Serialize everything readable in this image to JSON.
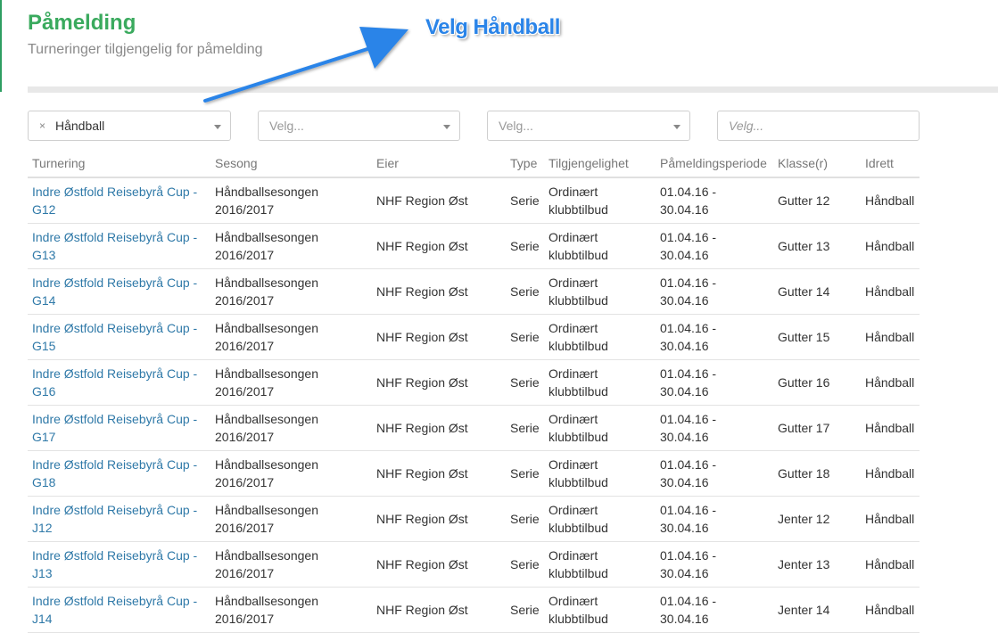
{
  "header": {
    "title": "Påmelding",
    "subtitle": "Turneringer tilgjengelig for påmelding"
  },
  "annotation": {
    "text": "Velg Håndball",
    "color": "#2a84e8"
  },
  "filters": {
    "sport": {
      "clear_symbol": "×",
      "value": "Håndball"
    },
    "filter2": {
      "placeholder": "Velg..."
    },
    "filter3": {
      "placeholder": "Velg..."
    },
    "search": {
      "placeholder": "Velg..."
    }
  },
  "table": {
    "columns": [
      "Turnering",
      "Sesong",
      "Eier",
      "Type",
      "Tilgjengelighet",
      "Påmeldingsperiode",
      "Klasse(r)",
      "Idrett"
    ],
    "rows": [
      {
        "turnering": [
          "Indre Østfold Reisebyrå Cup -",
          "G12"
        ],
        "sesong": [
          "Håndballsesongen",
          "2016/2017"
        ],
        "eier": "NHF Region Øst",
        "type": "Serie",
        "tilgjengelighet": [
          "Ordinært",
          "klubbtilbud"
        ],
        "periode": [
          "01.04.16 -",
          "30.04.16"
        ],
        "klasse": "Gutter 12",
        "idrett": "Håndball"
      },
      {
        "turnering": [
          "Indre Østfold Reisebyrå Cup -",
          "G13"
        ],
        "sesong": [
          "Håndballsesongen",
          "2016/2017"
        ],
        "eier": "NHF Region Øst",
        "type": "Serie",
        "tilgjengelighet": [
          "Ordinært",
          "klubbtilbud"
        ],
        "periode": [
          "01.04.16 -",
          "30.04.16"
        ],
        "klasse": "Gutter 13",
        "idrett": "Håndball"
      },
      {
        "turnering": [
          "Indre Østfold Reisebyrå Cup -",
          "G14"
        ],
        "sesong": [
          "Håndballsesongen",
          "2016/2017"
        ],
        "eier": "NHF Region Øst",
        "type": "Serie",
        "tilgjengelighet": [
          "Ordinært",
          "klubbtilbud"
        ],
        "periode": [
          "01.04.16 -",
          "30.04.16"
        ],
        "klasse": "Gutter 14",
        "idrett": "Håndball"
      },
      {
        "turnering": [
          "Indre Østfold Reisebyrå Cup -",
          "G15"
        ],
        "sesong": [
          "Håndballsesongen",
          "2016/2017"
        ],
        "eier": "NHF Region Øst",
        "type": "Serie",
        "tilgjengelighet": [
          "Ordinært",
          "klubbtilbud"
        ],
        "periode": [
          "01.04.16 -",
          "30.04.16"
        ],
        "klasse": "Gutter 15",
        "idrett": "Håndball"
      },
      {
        "turnering": [
          "Indre Østfold Reisebyrå Cup -",
          "G16"
        ],
        "sesong": [
          "Håndballsesongen",
          "2016/2017"
        ],
        "eier": "NHF Region Øst",
        "type": "Serie",
        "tilgjengelighet": [
          "Ordinært",
          "klubbtilbud"
        ],
        "periode": [
          "01.04.16 -",
          "30.04.16"
        ],
        "klasse": "Gutter 16",
        "idrett": "Håndball"
      },
      {
        "turnering": [
          "Indre Østfold Reisebyrå Cup -",
          "G17"
        ],
        "sesong": [
          "Håndballsesongen",
          "2016/2017"
        ],
        "eier": "NHF Region Øst",
        "type": "Serie",
        "tilgjengelighet": [
          "Ordinært",
          "klubbtilbud"
        ],
        "periode": [
          "01.04.16 -",
          "30.04.16"
        ],
        "klasse": "Gutter 17",
        "idrett": "Håndball"
      },
      {
        "turnering": [
          "Indre Østfold Reisebyrå Cup -",
          "G18"
        ],
        "sesong": [
          "Håndballsesongen",
          "2016/2017"
        ],
        "eier": "NHF Region Øst",
        "type": "Serie",
        "tilgjengelighet": [
          "Ordinært",
          "klubbtilbud"
        ],
        "periode": [
          "01.04.16 -",
          "30.04.16"
        ],
        "klasse": "Gutter 18",
        "idrett": "Håndball"
      },
      {
        "turnering": [
          "Indre Østfold Reisebyrå Cup -",
          "J12"
        ],
        "sesong": [
          "Håndballsesongen",
          "2016/2017"
        ],
        "eier": "NHF Region Øst",
        "type": "Serie",
        "tilgjengelighet": [
          "Ordinært",
          "klubbtilbud"
        ],
        "periode": [
          "01.04.16 -",
          "30.04.16"
        ],
        "klasse": "Jenter 12",
        "idrett": "Håndball"
      },
      {
        "turnering": [
          "Indre Østfold Reisebyrå Cup -",
          "J13"
        ],
        "sesong": [
          "Håndballsesongen",
          "2016/2017"
        ],
        "eier": "NHF Region Øst",
        "type": "Serie",
        "tilgjengelighet": [
          "Ordinært",
          "klubbtilbud"
        ],
        "periode": [
          "01.04.16 -",
          "30.04.16"
        ],
        "klasse": "Jenter 13",
        "idrett": "Håndball"
      },
      {
        "turnering": [
          "Indre Østfold Reisebyrå Cup -",
          "J14"
        ],
        "sesong": [
          "Håndballsesongen",
          "2016/2017"
        ],
        "eier": "NHF Region Øst",
        "type": "Serie",
        "tilgjengelighet": [
          "Ordinært",
          "klubbtilbud"
        ],
        "periode": [
          "01.04.16 -",
          "30.04.16"
        ],
        "klasse": "Jenter 14",
        "idrett": "Håndball"
      }
    ]
  },
  "colors": {
    "title": "#3aaa5e",
    "link": "#2f79a8",
    "subtitle": "#8a8a8a",
    "annotation": "#2a84e8"
  }
}
